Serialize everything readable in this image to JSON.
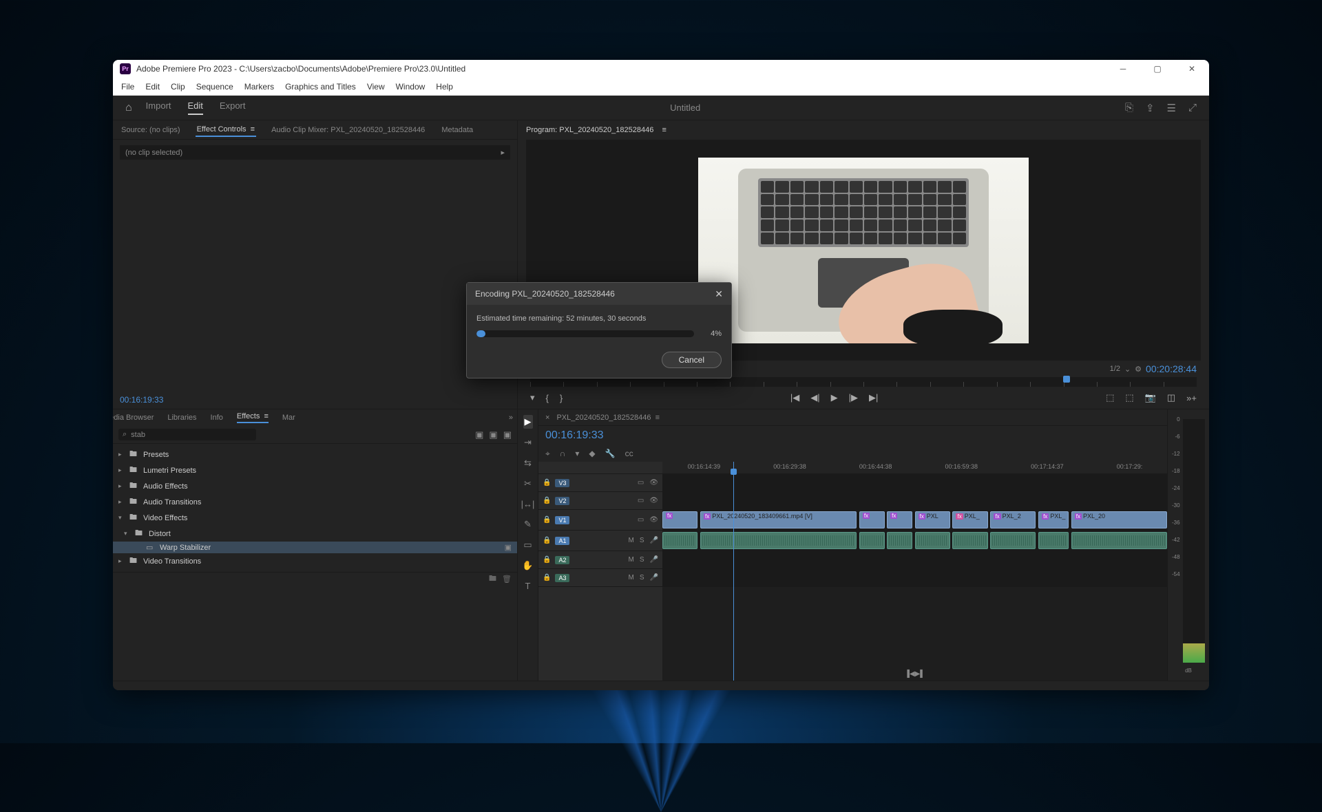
{
  "title": "Adobe Premiere Pro 2023 - C:\\Users\\zacbo\\Documents\\Adobe\\Premiere Pro\\23.0\\Untitled",
  "app_short": "Pr",
  "menu": [
    "File",
    "Edit",
    "Clip",
    "Sequence",
    "Markers",
    "Graphics and Titles",
    "View",
    "Window",
    "Help"
  ],
  "workspace": {
    "tabs": [
      "Import",
      "Edit",
      "Export"
    ],
    "active": 1,
    "center": "Untitled"
  },
  "source_panel": {
    "tabs": [
      "Source: (no clips)",
      "Effect Controls",
      "Audio Clip Mixer: PXL_20240520_182528446",
      "Metadata"
    ],
    "active": 1,
    "no_clip": "(no clip selected)",
    "timecode": "00:16:19:33"
  },
  "lower_left": {
    "tabs": [
      "Media Browser",
      "Libraries",
      "Info",
      "Effects",
      "Mar"
    ],
    "active": 3,
    "search": "stab",
    "tree": [
      {
        "level": 0,
        "arrow": "▸",
        "icon": "folder",
        "label": "Presets"
      },
      {
        "level": 0,
        "arrow": "▸",
        "icon": "folder",
        "label": "Lumetri Presets"
      },
      {
        "level": 0,
        "arrow": "▸",
        "icon": "folder",
        "label": "Audio Effects"
      },
      {
        "level": 0,
        "arrow": "▸",
        "icon": "folder",
        "label": "Audio Transitions"
      },
      {
        "level": 0,
        "arrow": "▾",
        "icon": "folder",
        "label": "Video Effects"
      },
      {
        "level": 1,
        "arrow": "▾",
        "icon": "folder",
        "label": "Distort"
      },
      {
        "level": 2,
        "arrow": "",
        "icon": "fx",
        "label": "Warp Stabilizer",
        "selected": true
      },
      {
        "level": 0,
        "arrow": "▸",
        "icon": "folder",
        "label": "Video Transitions"
      }
    ]
  },
  "program_panel": {
    "tab": "Program: PXL_20240520_182528446",
    "zoom": "1/2",
    "timecode": "00:20:28:44"
  },
  "timeline": {
    "tab": "PXL_20240520_182528446",
    "timecode": "00:16:19:33",
    "ruler": [
      "00:16:14:39",
      "00:16:29:38",
      "00:16:44:38",
      "00:16:59:38",
      "00:17:14:37",
      "00:17:29:"
    ],
    "video_tracks": [
      "V3",
      "V2",
      "V1"
    ],
    "audio_tracks": [
      "A1",
      "A2",
      "A3"
    ],
    "clip_main": "PXL_20240520_183409661.mp4 [V]",
    "clip_short": [
      "PXL",
      "PXL_",
      "PXL_2",
      "PXL_",
      "PXL_20"
    ]
  },
  "meter_labels": [
    "0",
    "-6",
    "-12",
    "-18",
    "-24",
    "-30",
    "-36",
    "-42",
    "-48",
    "-54",
    "dB"
  ],
  "dialog": {
    "title": "Encoding PXL_20240520_182528446",
    "eta": "Estimated time remaining: 52 minutes, 30 seconds",
    "pct": "4%",
    "cancel": "Cancel"
  }
}
